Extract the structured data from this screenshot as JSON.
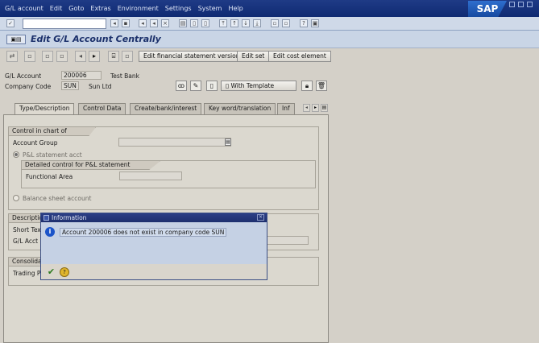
{
  "menubar": {
    "items": [
      "G/L account",
      "Edit",
      "Goto",
      "Extras",
      "Environment",
      "Settings",
      "System",
      "Help"
    ],
    "logo": "SAP"
  },
  "std_toolbar": {
    "command_placeholder": ""
  },
  "title": {
    "text": "Edit G/L Account Centrally"
  },
  "app_toolbar": {
    "buttons": [
      "Edit financial statement version",
      "Edit set",
      "Edit cost element"
    ]
  },
  "header": {
    "gl_account_label": "G/L Account",
    "gl_account_value": "200006",
    "gl_account_desc": "Test Bank",
    "company_code_label": "Company Code",
    "company_code_value": "SUN",
    "company_code_desc": "Sun Ltd",
    "with_template_label": "With Template"
  },
  "tabs": [
    "Type/Description",
    "Control Data",
    "Create/bank/interest",
    "Key word/translation",
    "Inf"
  ],
  "panel": {
    "coa_group_title": "Control in chart of accounts",
    "account_group_label": "Account Group",
    "pl_statement_label": "P&L statement acct",
    "detailed_title": "Detailed control for P&L statement accounts",
    "functional_area_label": "Functional Area",
    "balance_sheet_label": "Balance sheet account",
    "description_title": "Description",
    "short_text_label": "Short Text",
    "gl_acct_long_label": "G/L Acct L",
    "consolidation_title": "Consolidati",
    "trading_partner_label": "Trading P"
  },
  "dialog": {
    "title": "Information",
    "message": "Account 200006 does not exist in company code SUN"
  }
}
